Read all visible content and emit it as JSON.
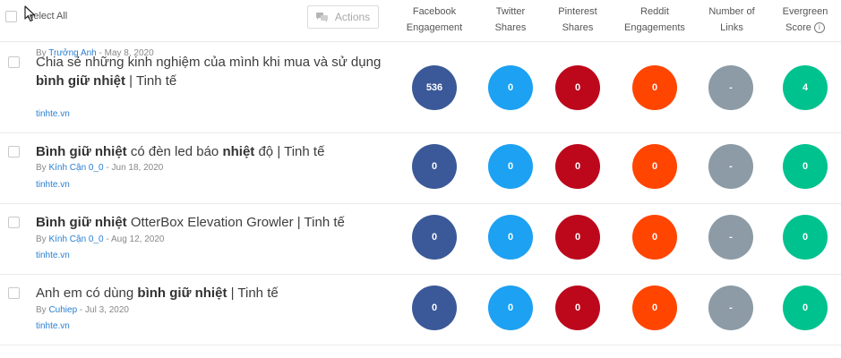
{
  "header": {
    "select_all_label": "Select All",
    "actions_label": "Actions",
    "columns": [
      {
        "line1": "Facebook",
        "line2": "Engagement"
      },
      {
        "line1": "Twitter",
        "line2": "Shares"
      },
      {
        "line1": "Pinterest",
        "line2": "Shares"
      },
      {
        "line1": "Reddit",
        "line2": "Engagements"
      },
      {
        "line1": "Number of",
        "line2": "Links"
      },
      {
        "line1": "Evergreen",
        "line2": "Score",
        "info": "i"
      }
    ]
  },
  "colors": {
    "facebook": "#3b5998",
    "twitter": "#1da1f2",
    "pinterest": "#bd081c",
    "reddit": "#ff4500",
    "links": "#8c9ba5",
    "evergreen": "#00c28f",
    "link_text": "#2a7fd0"
  },
  "rows": [
    {
      "title": [
        {
          "text": "Chia sẻ những kinh nghiệm của mình khi mua và sử dụng ",
          "bold": false
        },
        {
          "text": "bình giữ nhiệt",
          "bold": true
        },
        {
          "text": " | Tinh tế",
          "bold": false
        }
      ],
      "by": "By ",
      "author": "Trưởng Anh",
      "date": " - May 8, 2020",
      "domain": "tinhte.vn",
      "metrics": [
        "536",
        "0",
        "0",
        "0",
        "-",
        "4"
      ]
    },
    {
      "title": [
        {
          "text": "Bình giữ nhiệt",
          "bold": true
        },
        {
          "text": " có đèn led báo ",
          "bold": false
        },
        {
          "text": "nhiệt",
          "bold": true
        },
        {
          "text": " độ | Tinh tế",
          "bold": false
        }
      ],
      "by": "By ",
      "author": "Kính Cận 0_0",
      "date": " - Jun 18, 2020",
      "domain": "tinhte.vn",
      "metrics": [
        "0",
        "0",
        "0",
        "0",
        "-",
        "0"
      ]
    },
    {
      "title": [
        {
          "text": "Bình giữ nhiệt",
          "bold": true
        },
        {
          "text": " OtterBox Elevation Growler | Tinh tế",
          "bold": false
        }
      ],
      "by": "By ",
      "author": "Kính Cận 0_0",
      "date": " - Aug 12, 2020",
      "domain": "tinhte.vn",
      "metrics": [
        "0",
        "0",
        "0",
        "0",
        "-",
        "0"
      ]
    },
    {
      "title": [
        {
          "text": "Anh em có dùng ",
          "bold": false
        },
        {
          "text": "bình giữ nhiệt",
          "bold": true
        },
        {
          "text": " | Tinh tế",
          "bold": false
        }
      ],
      "by": "By ",
      "author": "Cuhiep",
      "date": " - Jul 3, 2020",
      "domain": "tinhte.vn",
      "metrics": [
        "0",
        "0",
        "0",
        "0",
        "-",
        "0"
      ]
    }
  ]
}
